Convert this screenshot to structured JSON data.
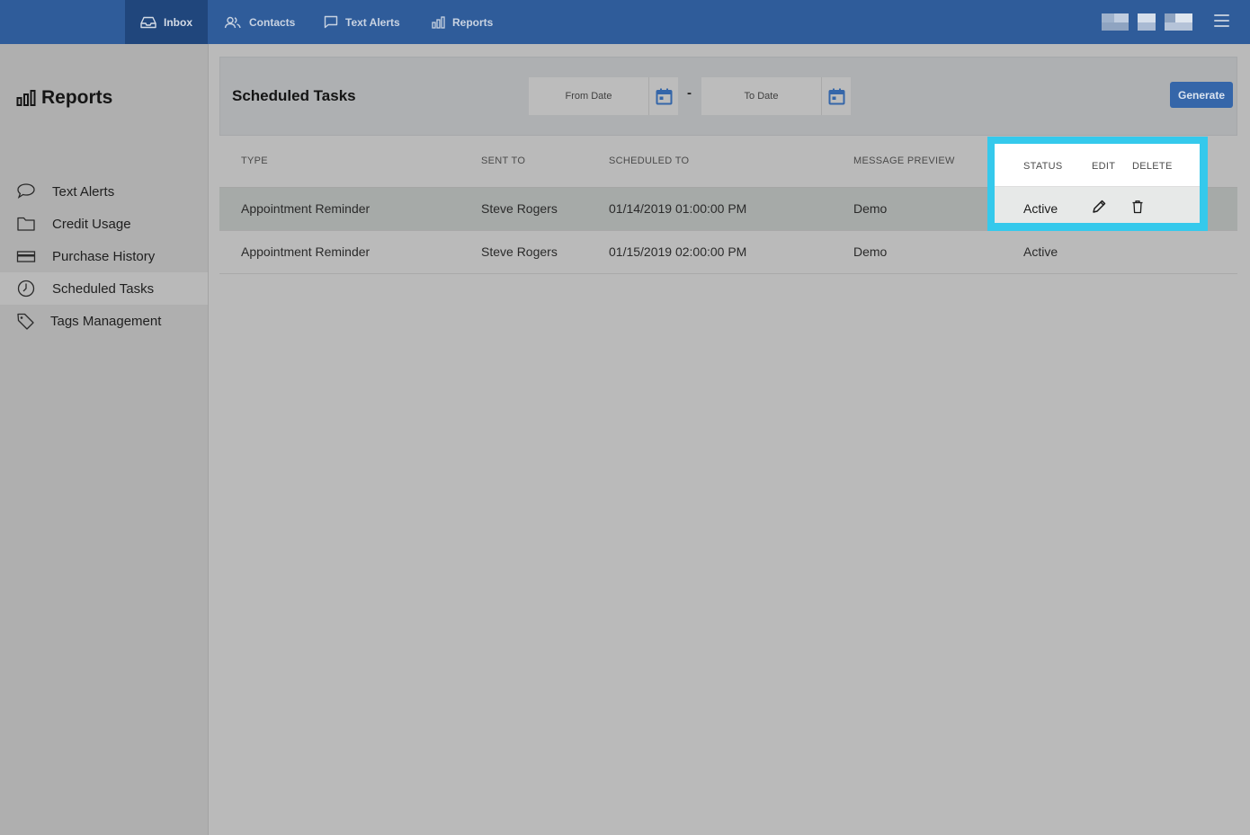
{
  "nav": {
    "tabs": [
      {
        "label": "Inbox",
        "icon": "inbox-icon"
      },
      {
        "label": "Contacts",
        "icon": "contacts-icon"
      },
      {
        "label": "Text Alerts",
        "icon": "chat-bubble-icon"
      },
      {
        "label": "Reports",
        "icon": "bar-chart-icon"
      }
    ],
    "active_tab": "Inbox"
  },
  "sidebar": {
    "title": "Reports",
    "items": [
      {
        "label": "Text Alerts",
        "icon": "chat-bubble-icon"
      },
      {
        "label": "Credit Usage",
        "icon": "folder-icon"
      },
      {
        "label": "Purchase History",
        "icon": "credit-card-icon"
      },
      {
        "label": "Scheduled Tasks",
        "icon": "clock-icon"
      },
      {
        "label": "Tags Management",
        "icon": "tag-icon"
      }
    ],
    "active_item": "Scheduled Tasks"
  },
  "page": {
    "title": "Scheduled Tasks",
    "from_date_placeholder": "From Date",
    "to_date_placeholder": "To Date",
    "separator": "-",
    "generate_label": "Generate"
  },
  "table": {
    "columns": [
      "TYPE",
      "SENT TO",
      "SCHEDULED TO",
      "MESSAGE PREVIEW",
      "STATUS",
      "EDIT",
      "DELETE"
    ],
    "rows": [
      {
        "type": "Appointment Reminder",
        "sent_to": "Steve Rogers",
        "scheduled_to": "01/14/2019 01:00:00 PM",
        "message_preview": "Demo",
        "status": "Active"
      },
      {
        "type": "Appointment Reminder",
        "sent_to": "Steve Rogers",
        "scheduled_to": "01/15/2019 02:00:00 PM",
        "message_preview": "Demo",
        "status": "Active"
      }
    ]
  },
  "colors": {
    "topbar": "#2f5c9a",
    "active_tab": "#20467c",
    "highlight": "#35c9ec",
    "button": "#3566a9"
  }
}
